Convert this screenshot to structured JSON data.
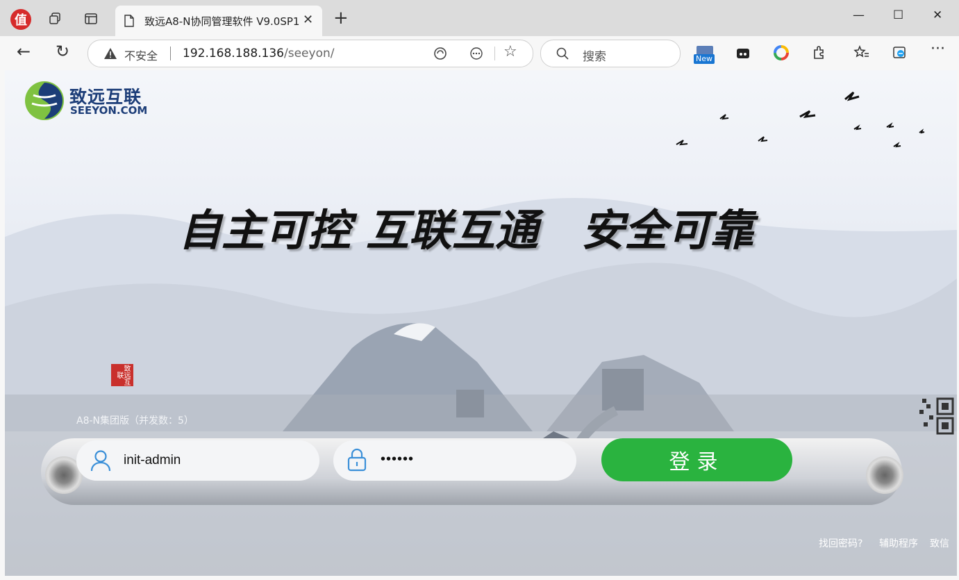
{
  "browser": {
    "tab_title": "致远A8-N协同管理软件 V9.0SP1",
    "insecure_label": "不安全",
    "url_host": "192.168.188.136",
    "url_path": "/seeyon/",
    "search_placeholder": "搜索",
    "extension_badge": "New"
  },
  "page": {
    "logo_cn": "致远互联",
    "logo_en": "SEEYON.COM",
    "slogans": [
      "自主可控",
      "互联互通",
      "安全可靠"
    ],
    "seal_text": "致远互联",
    "version": "A8-N集团版（并发数：5）",
    "username": "init-admin",
    "password_mask": "••••••",
    "login_label": "登录",
    "links": [
      "找回密码?",
      "辅助程序",
      "致信"
    ]
  },
  "colors": {
    "accent": "#2ab33f",
    "logo": "#1c3d78",
    "seal": "#c9302c"
  }
}
